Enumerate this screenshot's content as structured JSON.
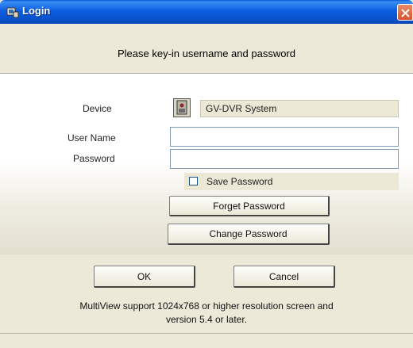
{
  "window": {
    "title": "Login"
  },
  "header": {
    "text": "Please key-in username and password"
  },
  "form": {
    "device_label": "Device",
    "device_value": "GV-DVR System",
    "username_label": "User Name",
    "username_value": "",
    "password_label": "Password",
    "password_value": "",
    "save_password_label": "Save Password",
    "save_password_checked": false
  },
  "buttons": {
    "forget_password": "Forget Password",
    "change_password": "Change Password",
    "ok": "OK",
    "cancel": "Cancel"
  },
  "footer": {
    "line1": "MultiView support 1024x768 or higher resolution screen and",
    "line2": "version 5.4 or later."
  },
  "icons": {
    "app": "app-icon",
    "close": "close-icon",
    "device": "device-icon"
  }
}
